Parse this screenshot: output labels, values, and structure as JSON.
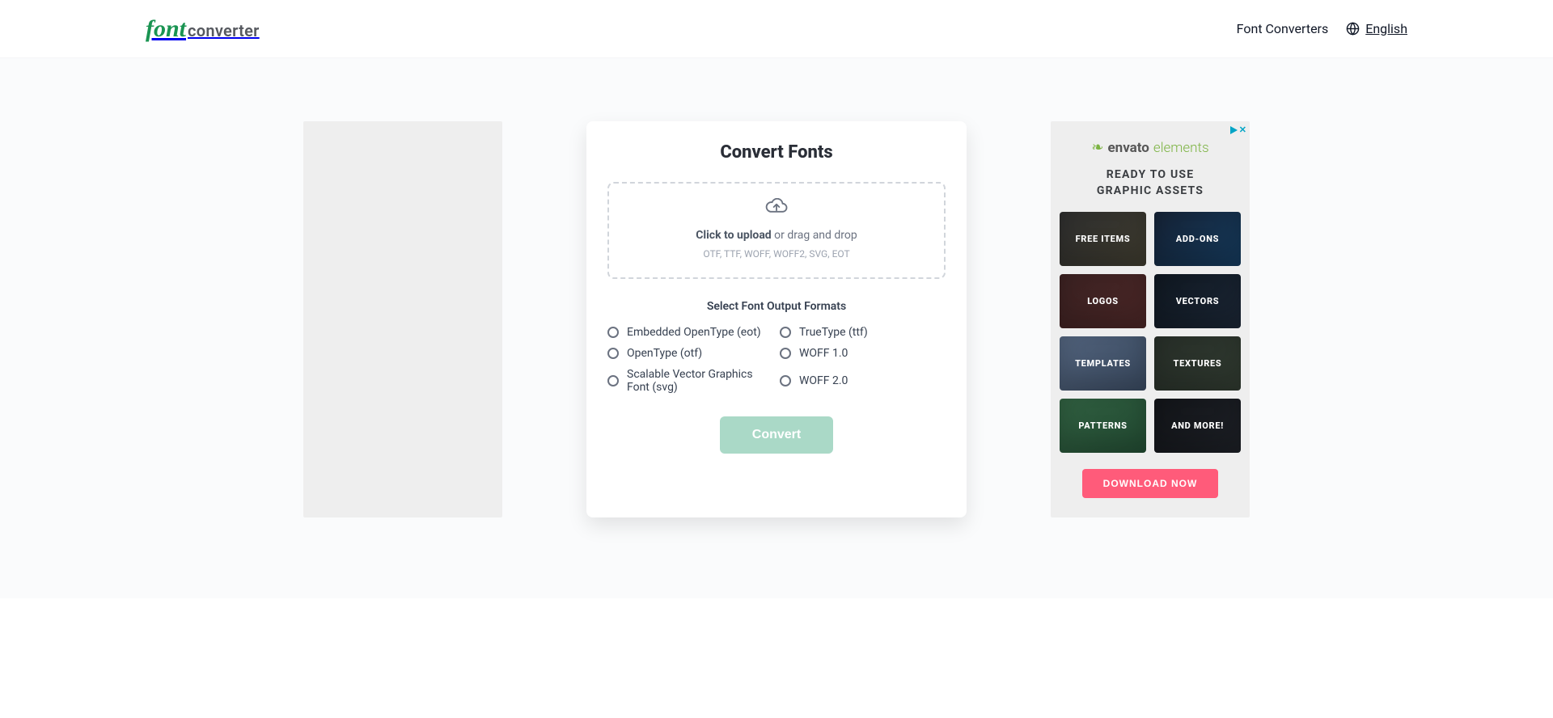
{
  "header": {
    "logo_script": "font",
    "logo_rest": "converter",
    "nav_converters": "Font Converters",
    "nav_language": "English"
  },
  "card": {
    "title": "Convert Fonts",
    "upload_bold": "Click to upload",
    "upload_rest": " or drag and drop",
    "upload_formats": "OTF, TTF, WOFF, WOFF2, SVG, EOT",
    "section_label": "Select Font Output Formats",
    "convert_label": "Convert",
    "formats_left": [
      "Embedded OpenType (eot)",
      "OpenType (otf)",
      "Scalable Vector Graphics Font (svg)"
    ],
    "formats_right": [
      "TrueType (ttf)",
      "WOFF 1.0",
      "WOFF 2.0"
    ]
  },
  "ad": {
    "brand1": "envato",
    "brand2": "elements",
    "headline1": "READY TO USE",
    "headline2": "GRAPHIC ASSETS",
    "tiles": [
      "FREE ITEMS",
      "ADD-ONS",
      "LOGOS",
      "VECTORS",
      "TEMPLATES",
      "TEXTURES",
      "PATTERNS",
      "AND MORE!"
    ],
    "cta": "DOWNLOAD NOW"
  }
}
